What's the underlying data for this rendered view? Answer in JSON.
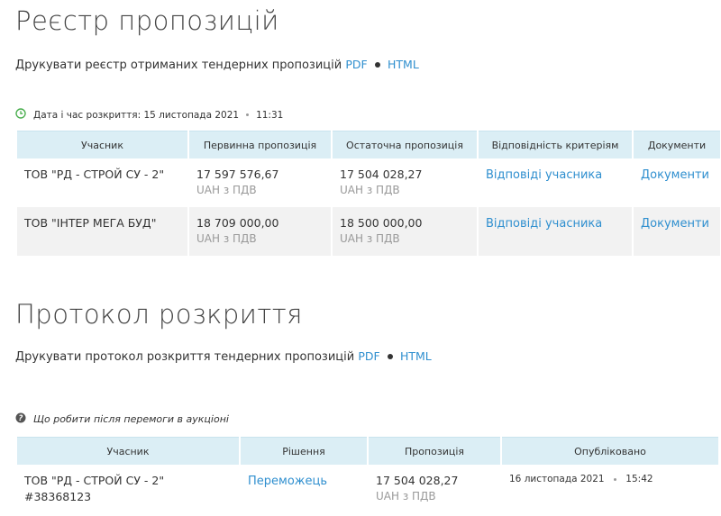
{
  "registry": {
    "title": "Реєстр пропозицій",
    "print_text": "Друкувати реєстр отриманих тендерних пропозицій",
    "pdf_label": "PDF",
    "html_label": "HTML",
    "opening_label": "Дата і час розкриття: 15 листопада 2021",
    "opening_time": "11:31",
    "columns": [
      "Учасник",
      "Первинна пропозиція",
      "Остаточна пропозиція",
      "Відповідність критеріям",
      "Документи"
    ],
    "rows": [
      {
        "participant": "ТОВ \"РД - СТРОЙ СУ - 2\"",
        "initial": "17 597 576,67",
        "initial_sub": "UAH з ПДВ",
        "final": "17 504 028,27",
        "final_sub": "UAH з ПДВ",
        "criteria": "Відповіді учасника",
        "documents": "Документи"
      },
      {
        "participant": "ТОВ \"ІНТЕР МЕГА БУД\"",
        "initial": "18 709 000,00",
        "initial_sub": "UAH з ПДВ",
        "final": "18 500 000,00",
        "final_sub": "UAH з ПДВ",
        "criteria": "Відповіді учасника",
        "documents": "Документи"
      }
    ]
  },
  "protocol": {
    "title": "Протокол розкриття",
    "print_text": "Друкувати протокол розкриття тендерних пропозицій",
    "pdf_label": "PDF",
    "html_label": "HTML",
    "help_text": "Що робити після перемоги в аукціоні",
    "columns": [
      "Учасник",
      "Рішення",
      "Пропозиція",
      "Опубліковано"
    ],
    "rows": [
      {
        "participant": "ТОВ \"РД - СТРОЙ СУ - 2\"",
        "participant_id": "#38368123",
        "decision": "Переможець",
        "offer": "17 504 028,27",
        "offer_sub": "UAH з ПДВ",
        "published_date": "16 листопада 2021",
        "published_time": "15:42"
      }
    ]
  },
  "colors": {
    "link": "#2f8fcf",
    "header_bg": "#dbeef5",
    "row_alt_bg": "#f2f2f2",
    "clock_icon": "#4caf50"
  }
}
